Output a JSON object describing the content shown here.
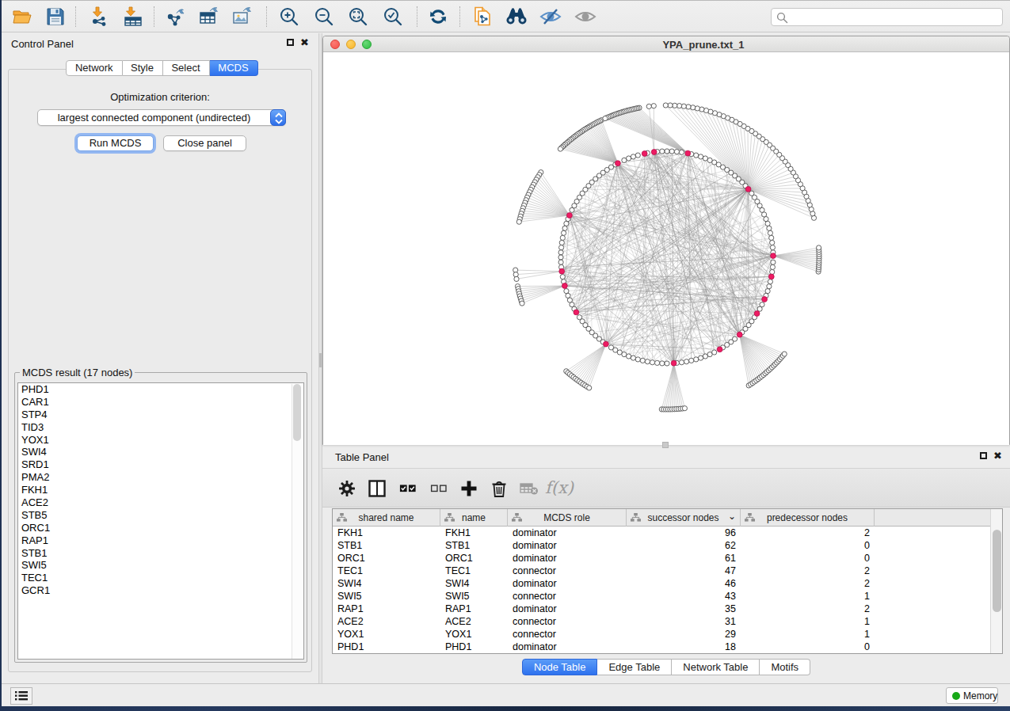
{
  "toolbar": {
    "icons": [
      "open-session",
      "save-session",
      "import-network",
      "import-table",
      "export-network",
      "export-table",
      "export-image",
      "zoom-in",
      "zoom-out",
      "zoom-fit",
      "zoom-selected",
      "apply-layout",
      "clone-network",
      "search-network",
      "hide-selected",
      "show-all"
    ],
    "search": {
      "placeholder": ""
    }
  },
  "control_panel": {
    "title": "Control Panel",
    "tabs": [
      {
        "label": "Network",
        "active": false
      },
      {
        "label": "Style",
        "active": false
      },
      {
        "label": "Select",
        "active": false
      },
      {
        "label": "MCDS",
        "active": true
      }
    ],
    "mcds": {
      "criterion_label": "Optimization criterion:",
      "criterion_value": "largest connected component (undirected)",
      "run_button": "Run MCDS",
      "close_button": "Close panel",
      "result_title": "MCDS result (17 nodes)",
      "result_nodes": [
        "PHD1",
        "CAR1",
        "STP4",
        "TID3",
        "YOX1",
        "SWI4",
        "SRD1",
        "PMA2",
        "FKH1",
        "ACE2",
        "STB5",
        "ORC1",
        "RAP1",
        "STB1",
        "SWI5",
        "TEC1",
        "GCR1"
      ]
    }
  },
  "network_view": {
    "title": "YPA_prune.txt_1"
  },
  "chart_data": {
    "type": "network",
    "layout": "circular-with-satellite-arcs",
    "title": "YPA_prune.txt_1",
    "center": [
      434,
      258
    ],
    "ring_radius": 134,
    "outer_radius": 192,
    "ring_node_count": 136,
    "node_radius": 3.1,
    "hub_node_radius": 3.4,
    "colors": {
      "node_fill": "#ffffff",
      "node_stroke": "#4e4e4e",
      "hub_fill": "#ee1c63",
      "hub_stroke": "#b60f4c",
      "edge": "#909090",
      "fan_edge": "#b4b4b4"
    },
    "seed": 11,
    "hubs": [
      {
        "angle": 117.6,
        "fan_start": 115.5,
        "fan_end": 134.5,
        "fan_count": 30,
        "chords": 24
      },
      {
        "angle": 102.2,
        "fan_count": 0,
        "chords": 11
      },
      {
        "angle": 97.0,
        "fan_start": 95.0,
        "fan_end": 96.8,
        "fan_count": 2,
        "chords": 20
      },
      {
        "angle": 78.7,
        "fan_start": 100.5,
        "fan_end": 114.0,
        "fan_count": 22,
        "chords": 20
      },
      {
        "angle": 40.0,
        "fan_start": 15.0,
        "fan_end": 90.5,
        "fan_count": 45,
        "chords": 40
      },
      {
        "angle": 0.8,
        "fan_start": -5.4,
        "fan_end": 3.6,
        "fan_count": 12,
        "chords": 23
      },
      {
        "angle": -10.5,
        "fan_count": 0,
        "chords": 10
      },
      {
        "angle": -23.3,
        "fan_count": 0,
        "chords": 10
      },
      {
        "angle": -32.0,
        "fan_count": 0,
        "chords": 10
      },
      {
        "angle": -46.8,
        "fan_start": -57.5,
        "fan_end": -39.5,
        "fan_count": 22,
        "chords": 20
      },
      {
        "angle": -60.2,
        "fan_count": 0,
        "chords": 10
      },
      {
        "angle": -86.3,
        "fan_start": -92.0,
        "fan_end": -83.3,
        "fan_count": 12,
        "chords": 23
      },
      {
        "angle": -125.1,
        "fan_start": -131.5,
        "fan_end": -120.8,
        "fan_count": 13,
        "chords": 16
      },
      {
        "angle": -148.8,
        "fan_count": 0,
        "chords": 10
      },
      {
        "angle": 156.7,
        "fan_start": 146.0,
        "fan_end": 166.5,
        "fan_count": 20,
        "chords": 20
      },
      {
        "angle": 187.6,
        "fan_start": 184.8,
        "fan_end": 188.2,
        "fan_count": 3,
        "chords": 11
      },
      {
        "angle": 195.6,
        "fan_start": 191.0,
        "fan_end": 197.6,
        "fan_count": 8,
        "chords": 12
      }
    ],
    "extra_ring_chords": 24
  },
  "table_panel": {
    "title": "Table Panel",
    "toolbar_icons": [
      "settings",
      "split-panel",
      "select-all",
      "deselect-all",
      "add-column",
      "delete-column",
      "delete-table",
      "function-builder"
    ],
    "fx_label": "f(x)",
    "columns": [
      {
        "label": "shared name",
        "width": 136,
        "align": "left"
      },
      {
        "label": "name",
        "width": 85,
        "align": "left"
      },
      {
        "label": "MCDS role",
        "width": 150,
        "align": "left"
      },
      {
        "label": "successor nodes",
        "width": 144,
        "align": "right",
        "sorted": true
      },
      {
        "label": "predecessor nodes",
        "width": 169,
        "align": "right"
      },
      {
        "label": "",
        "width": 147,
        "align": "left"
      }
    ],
    "rows": [
      {
        "shared_name": "FKH1",
        "name": "FKH1",
        "role": "dominator",
        "succ": "96",
        "pred": "2"
      },
      {
        "shared_name": "STB1",
        "name": "STB1",
        "role": "dominator",
        "succ": "62",
        "pred": "0"
      },
      {
        "shared_name": "ORC1",
        "name": "ORC1",
        "role": "dominator",
        "succ": "61",
        "pred": "0"
      },
      {
        "shared_name": "TEC1",
        "name": "TEC1",
        "role": "connector",
        "succ": "47",
        "pred": "2"
      },
      {
        "shared_name": "SWI4",
        "name": "SWI4",
        "role": "dominator",
        "succ": "46",
        "pred": "2"
      },
      {
        "shared_name": "SWI5",
        "name": "SWI5",
        "role": "connector",
        "succ": "43",
        "pred": "1"
      },
      {
        "shared_name": "RAP1",
        "name": "RAP1",
        "role": "dominator",
        "succ": "35",
        "pred": "2"
      },
      {
        "shared_name": "ACE2",
        "name": "ACE2",
        "role": "connector",
        "succ": "31",
        "pred": "1"
      },
      {
        "shared_name": "YOX1",
        "name": "YOX1",
        "role": "connector",
        "succ": "29",
        "pred": "1"
      },
      {
        "shared_name": "PHD1",
        "name": "PHD1",
        "role": "dominator",
        "succ": "18",
        "pred": "0"
      }
    ],
    "tabs": [
      {
        "label": "Node Table",
        "active": true
      },
      {
        "label": "Edge Table",
        "active": false
      },
      {
        "label": "Network Table",
        "active": false
      },
      {
        "label": "Motifs",
        "active": false
      }
    ]
  },
  "status_bar": {
    "memory_label": "Memory"
  }
}
